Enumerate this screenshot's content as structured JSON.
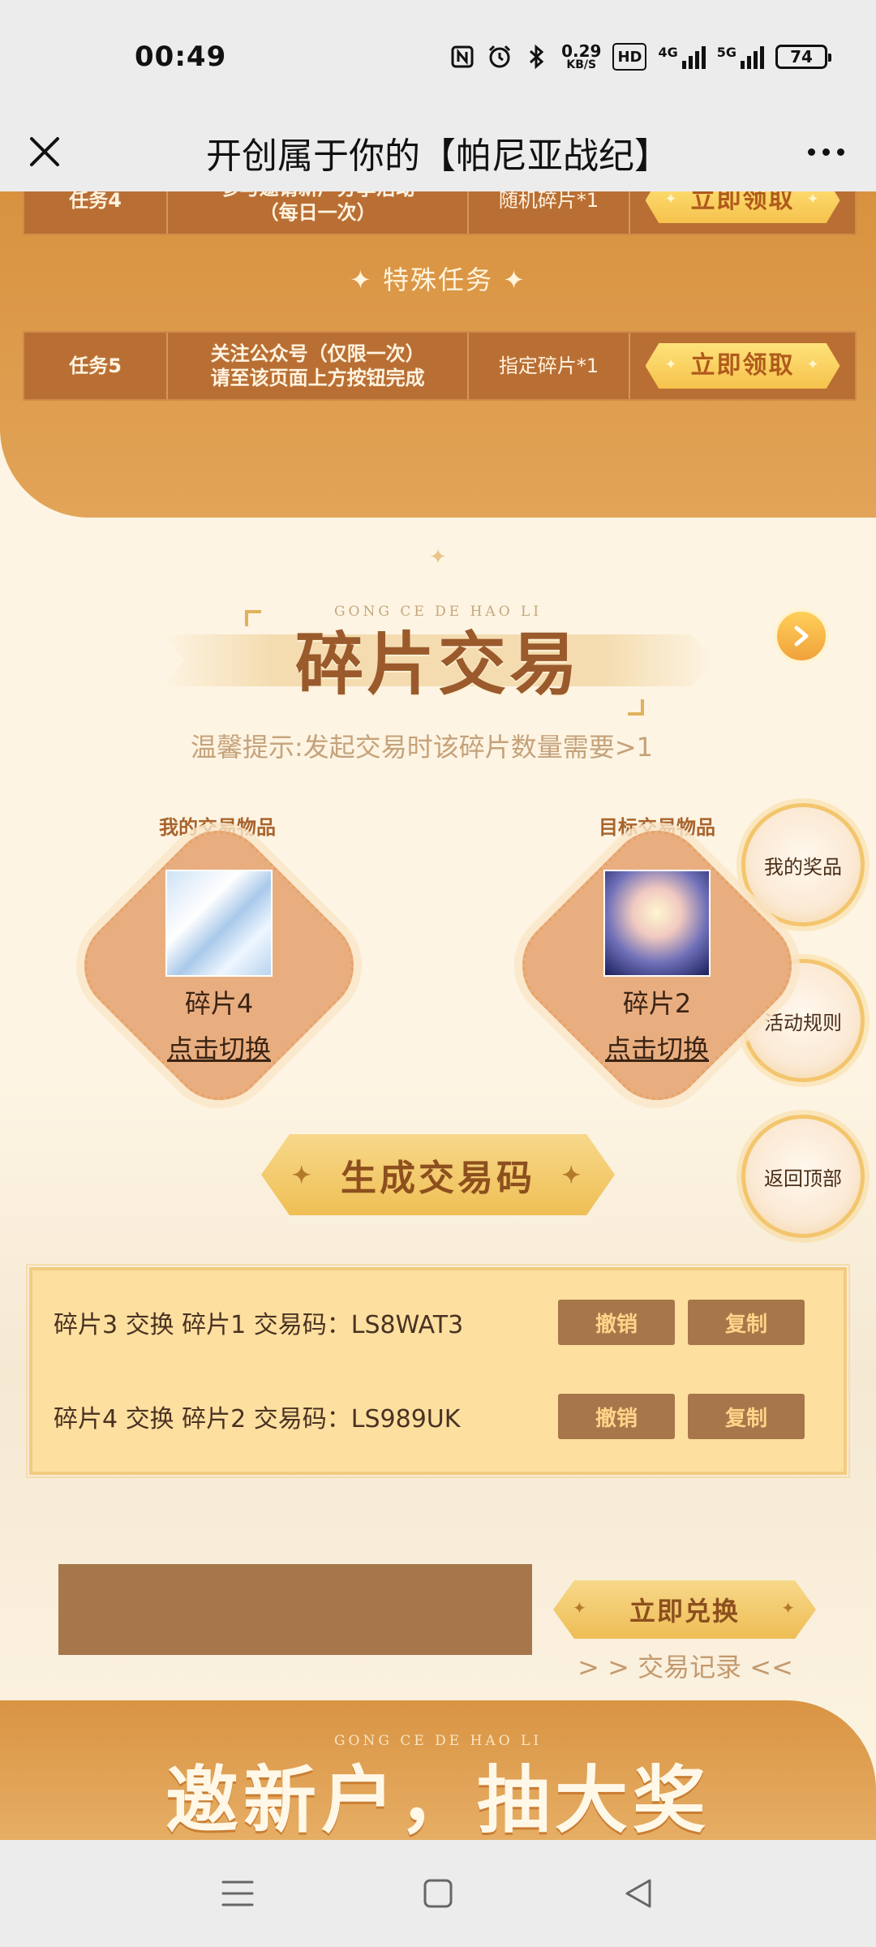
{
  "status": {
    "time": "00:49",
    "net_speed_value": "0.29",
    "net_speed_unit": "KB/S",
    "hd_label": "HD",
    "sig1_label": "4G",
    "sig2_label": "5G",
    "battery": "74"
  },
  "titlebar": {
    "title": "开创属于你的【帕尼亚战纪】"
  },
  "tasks": {
    "task4": {
      "name": "任务4",
      "desc_line1": "参与邀请新广分享活动",
      "desc_line2": "（每日一次）",
      "reward": "随机碎片*1",
      "button": "立即领取"
    },
    "special_title": "✦ 特殊任务 ✦",
    "task5": {
      "name": "任务5",
      "desc_line1": "关注公众号（仅限一次）",
      "desc_line2": "请至该页面上方按钮完成",
      "reward": "指定碎片*1",
      "button": "立即领取"
    }
  },
  "trade": {
    "subtitle_en": "GONG CE DE HAO LI",
    "title": "碎片交易",
    "tip": "温馨提示:发起交易时该碎片数量需要>1",
    "my_label": "我的交易物品",
    "target_label": "目标交易物品",
    "my_item_name": "碎片4",
    "target_item_name": "碎片2",
    "switch_label": "点击切换",
    "generate_button": "生成交易码",
    "codes": [
      {
        "text": "碎片3 交换 碎片1 交易码：LS8WAT3",
        "cancel": "撤销",
        "copy": "复制"
      },
      {
        "text": "碎片4 交换 碎片2 交易码：LS989UK",
        "cancel": "撤销",
        "copy": "复制"
      }
    ],
    "code_input_value": "",
    "redeem_button": "立即兑换",
    "record_link": "> > 交易记录 <<"
  },
  "side": {
    "my_prizes": "我的奖品",
    "rules": "活动规则",
    "back_top": "返回顶部"
  },
  "invite": {
    "subtitle_en": "GONG CE DE HAO LI",
    "title": "邀新户，抽大奖"
  },
  "colors": {
    "accent_orange": "#d8923f",
    "button_gold": "#f5c24c",
    "button_brown": "#a7764a"
  }
}
